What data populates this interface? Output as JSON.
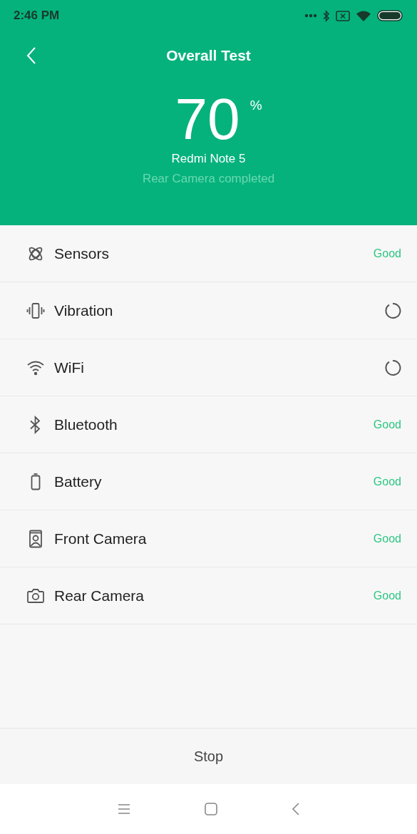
{
  "status_bar": {
    "time": "2:46 PM"
  },
  "header": {
    "title": "Overall Test",
    "percent": "70",
    "percent_sign": "%",
    "device": "Redmi Note 5",
    "progress_text": "Rear Camera completed"
  },
  "tests": [
    {
      "name": "Sensors",
      "kind": "done",
      "result": "Good"
    },
    {
      "name": "Vibration",
      "kind": "running"
    },
    {
      "name": "WiFi",
      "kind": "running"
    },
    {
      "name": "Bluetooth",
      "kind": "done",
      "result": "Good"
    },
    {
      "name": "Battery",
      "kind": "done",
      "result": "Good"
    },
    {
      "name": "Front Camera",
      "kind": "done",
      "result": "Good"
    },
    {
      "name": "Rear Camera",
      "kind": "done",
      "result": "Good"
    }
  ],
  "stop_button": "Stop"
}
